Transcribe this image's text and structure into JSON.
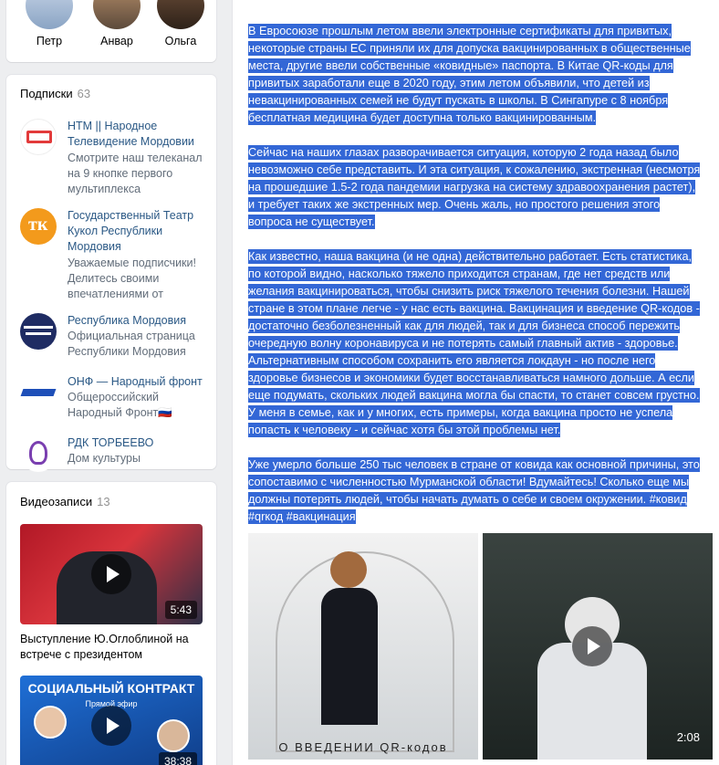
{
  "friends": [
    {
      "name": "Петр"
    },
    {
      "name": "Анвар"
    },
    {
      "name": "Ольга"
    }
  ],
  "subscriptions": {
    "title": "Подписки",
    "count": "63",
    "items": [
      {
        "name": "НТМ || Народное Телевидение Мордовии",
        "desc": "Смотрите наш телеканал на 9 кнопке первого мультиплекса"
      },
      {
        "name": "Государственный Театр Кукол Республики Мордовия",
        "desc": "Уважаемые подписчики! Делитесь своими впечатлениями от"
      },
      {
        "name": "Республика Мордовия",
        "desc": "Официальная страница Республики Мордовия"
      },
      {
        "name": "ОНФ — Народный фронт",
        "desc": "Общероссийский Народный Фронт🇷🇺"
      },
      {
        "name": "РДК ТОРБЕЕВО",
        "desc": "Дом культуры"
      }
    ]
  },
  "videos": {
    "title": "Видеозаписи",
    "count": "13",
    "items": [
      {
        "title": "Выступление Ю.Оглоблиной на встрече с президентом",
        "duration": "5:43"
      },
      {
        "title": "",
        "duration": "38:38",
        "overlay_title": "СОЦИАЛЬНЫЙ КОНТРАКТ",
        "overlay_sub": "Прямой эфир"
      }
    ]
  },
  "post": {
    "paragraphs": [
      "В Евросоюзе прошлым летом ввели электронные сертификаты для привитых, некоторые страны ЕС приняли их для допуска вакцинированных в общественные места, другие ввели собственные «ковидные» паспорта. В Китае QR-коды для привитых заработали еще в 2020 году, этим летом объявили, что детей из невакцинированных семей не будут пускать в школы. В Сингапуре с 8 ноября бесплатная медицина будет доступна только вакцинированным.",
      "Сейчас на наших глазах разворачивается ситуация, которую 2 года назад было невозможно себе представить. И эта ситуация, к сожалению, экстренная (несмотря на прошедшие 1.5-2 года пандемии нагрузка на систему здравоохранения растет), и требует таких же экстренных мер. Очень жаль, но простого решения этого вопроса не существует.",
      "Как известно, наша вакцина (и не одна) действительно работает. Есть статистика, по которой видно, насколько тяжело приходится странам, где нет средств или желания вакцинироваться, чтобы снизить риск тяжелого течения болезни. Нашей стране в этом плане легче - у нас есть вакцина. Вакцинация и введение QR-кодов - достаточно безболезненный как для людей, так и для бизнеса способ пережить очередную волну коронавируса и не потерять самый главный актив - здоровье. Альтернативным способом сохранить его является локдаун - но после него здоровье бизнесов и экономики будет восстанавливаться намного дольше. А если еще подумать, скольких людей вакцина могла бы спасти, то станет совсем грустно. У меня в семье, как и у многих, есть примеры, когда вакцина просто не успела попасть к человеку - и сейчас хотя бы этой проблемы нет.",
      "Уже умерло больше 250 тыс человек в стране от ковида как основной причины, это сопоставимо с численностью Мурманской области! Вдумайтесь! Сколько еще мы должны потерять людей, чтобы начать думать о себе и своем окружении. #ковид #qrкод #вакцинация"
    ],
    "photo_caption": "О ВВЕДЕНИИ QR-кодов",
    "video_duration": "2:08"
  },
  "colors": {
    "link": "#2a5885",
    "highlight": "#3367d6",
    "muted": "#939393"
  }
}
